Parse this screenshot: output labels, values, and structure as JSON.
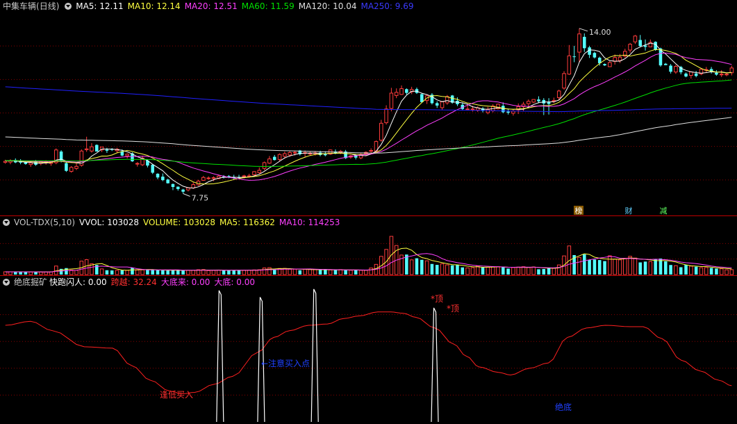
{
  "colors": {
    "up": "#ff3c3c",
    "down": "#54ffff",
    "divider": "#c00000",
    "grid": "#8a0000",
    "ma5": "#ffffff",
    "ma10": "#ffff40",
    "ma20": "#ff40ff",
    "ma60": "#00e000",
    "ma120": "#e0e0e0",
    "ma250": "#2020ff",
    "text": "#c8c8c8"
  },
  "price_panel": {
    "stock_name": "中集车辆",
    "period": "(日线)",
    "ma": [
      {
        "label": "MA5: 12.11",
        "color": "#ffffff"
      },
      {
        "label": "MA10: 12.14",
        "color": "#ffff40"
      },
      {
        "label": "MA20: 12.51",
        "color": "#ff40ff"
      },
      {
        "label": "MA60: 11.59",
        "color": "#00e000"
      },
      {
        "label": "MA120: 10.04",
        "color": "#e0e0e0"
      },
      {
        "label": "MA250: 9.69",
        "color": "#3a3aff"
      }
    ],
    "high_label": "14.00",
    "low_label": "7.75",
    "events": [
      {
        "text": "榜",
        "color": "#ffffff",
        "bg": "#8a5a00"
      },
      {
        "text": "财",
        "color": "#60d0ff",
        "bg": ""
      },
      {
        "text": "减",
        "color": "#60ff60",
        "bg": ""
      }
    ]
  },
  "volume_panel": {
    "title": "VOL-TDX(5,10)",
    "values": [
      {
        "label": "VVOL: 103028",
        "color": "#ffffff"
      },
      {
        "label": "VOLUME: 103028",
        "color": "#ffff40"
      },
      {
        "label": "MA5: 116362",
        "color": "#ffff40"
      },
      {
        "label": "MA10: 114253",
        "color": "#ff40ff"
      }
    ]
  },
  "indicator_panel": {
    "title": "绝底掘矿",
    "values": [
      {
        "label": "快跑闪人: 0.00",
        "color": "#ffffff"
      },
      {
        "label": "跨越: 32.24",
        "color": "#ff3030"
      },
      {
        "label": "大底来: 0.00",
        "color": "#ff40ff"
      },
      {
        "label": "大底: 0.00",
        "color": "#ff40ff"
      }
    ],
    "annotations": [
      {
        "text": "逢低买入",
        "color": "#ff3030"
      },
      {
        "text": "←注意买入点",
        "color": "#2040ff"
      },
      {
        "text": "*顶",
        "color": "#ff3030"
      },
      {
        "text": "*顶",
        "color": "#ff3030"
      },
      {
        "text": "绝底",
        "color": "#2040ff"
      }
    ]
  },
  "chart_data": [
    {
      "type": "candlestick",
      "title": "中集车辆(日线)",
      "ylim": [
        7.0,
        14.6
      ],
      "ohlc": [
        [
          8.93,
          9.03,
          8.88,
          8.97
        ],
        [
          8.94,
          9.05,
          8.86,
          8.99
        ],
        [
          9.02,
          9.08,
          8.9,
          8.93
        ],
        [
          8.98,
          9.05,
          8.86,
          8.92
        ],
        [
          8.93,
          9.0,
          8.84,
          8.87
        ],
        [
          8.85,
          8.97,
          8.76,
          8.91
        ],
        [
          8.97,
          9.02,
          8.8,
          8.84
        ],
        [
          8.89,
          8.96,
          8.82,
          8.95
        ],
        [
          8.92,
          9.01,
          8.84,
          8.96
        ],
        [
          8.89,
          8.96,
          8.8,
          8.95
        ],
        [
          8.92,
          9.46,
          8.86,
          9.4
        ],
        [
          9.34,
          9.39,
          8.93,
          9.0
        ],
        [
          8.9,
          8.97,
          8.57,
          8.61
        ],
        [
          8.59,
          8.79,
          8.54,
          8.74
        ],
        [
          8.7,
          8.89,
          8.64,
          8.78
        ],
        [
          8.82,
          9.42,
          8.77,
          9.36
        ],
        [
          9.41,
          9.9,
          9.33,
          9.44
        ],
        [
          9.36,
          9.66,
          9.3,
          9.52
        ],
        [
          9.59,
          9.61,
          9.34,
          9.34
        ],
        [
          9.4,
          9.52,
          9.32,
          9.51
        ],
        [
          9.41,
          9.48,
          9.29,
          9.37
        ],
        [
          9.43,
          9.47,
          9.36,
          9.42
        ],
        [
          9.37,
          9.48,
          9.28,
          9.43
        ],
        [
          9.35,
          9.42,
          9.16,
          9.19
        ],
        [
          9.18,
          9.27,
          9.08,
          9.24
        ],
        [
          9.27,
          9.31,
          8.95,
          8.97
        ],
        [
          8.87,
          8.94,
          8.77,
          8.89
        ],
        [
          8.84,
          9.18,
          8.79,
          9.09
        ],
        [
          9.0,
          9.03,
          8.74,
          8.81
        ],
        [
          8.84,
          8.86,
          8.49,
          8.54
        ],
        [
          8.5,
          8.52,
          8.29,
          8.36
        ],
        [
          8.39,
          8.51,
          8.22,
          8.26
        ],
        [
          8.28,
          8.31,
          8.13,
          8.14
        ],
        [
          8.11,
          8.13,
          7.88,
          8.0
        ],
        [
          8.01,
          8.02,
          7.86,
          7.92
        ],
        [
          7.9,
          7.93,
          7.75,
          7.82
        ],
        [
          7.89,
          8.0,
          7.83,
          7.97
        ],
        [
          7.96,
          8.18,
          7.92,
          8.09
        ],
        [
          8.08,
          8.27,
          8.04,
          8.22
        ],
        [
          8.25,
          8.42,
          8.23,
          8.36
        ],
        [
          8.32,
          8.4,
          8.28,
          8.34
        ],
        [
          8.32,
          8.4,
          8.22,
          8.35
        ],
        [
          8.32,
          8.47,
          8.29,
          8.41
        ],
        [
          8.39,
          8.45,
          8.32,
          8.38
        ],
        [
          8.41,
          8.45,
          8.33,
          8.37
        ],
        [
          8.37,
          8.46,
          8.29,
          8.33
        ],
        [
          8.37,
          8.46,
          8.3,
          8.34
        ],
        [
          8.4,
          8.46,
          8.32,
          8.42
        ],
        [
          8.4,
          8.5,
          8.38,
          8.42
        ],
        [
          8.46,
          8.6,
          8.42,
          8.58
        ],
        [
          8.54,
          8.74,
          8.5,
          8.63
        ],
        [
          8.7,
          8.96,
          8.63,
          8.92
        ],
        [
          8.9,
          9.17,
          8.87,
          9.06
        ],
        [
          9.14,
          9.21,
          9.0,
          9.02
        ],
        [
          9.04,
          9.27,
          8.98,
          9.23
        ],
        [
          9.16,
          9.34,
          9.07,
          9.26
        ],
        [
          9.21,
          9.37,
          9.14,
          9.3
        ],
        [
          9.3,
          9.37,
          9.19,
          9.31
        ],
        [
          9.38,
          9.4,
          9.19,
          9.24
        ],
        [
          9.27,
          9.38,
          9.14,
          9.3
        ],
        [
          9.25,
          9.35,
          9.18,
          9.27
        ],
        [
          9.28,
          9.36,
          9.19,
          9.29
        ],
        [
          9.3,
          9.37,
          9.16,
          9.21
        ],
        [
          9.24,
          9.35,
          9.16,
          9.2
        ],
        [
          9.24,
          9.42,
          9.21,
          9.4
        ],
        [
          9.34,
          9.42,
          9.24,
          9.26
        ],
        [
          9.29,
          9.4,
          9.24,
          9.35
        ],
        [
          9.34,
          9.4,
          9.06,
          9.09
        ],
        [
          9.13,
          9.22,
          9.07,
          9.18
        ],
        [
          9.21,
          9.25,
          9.04,
          9.11
        ],
        [
          9.1,
          9.28,
          9.05,
          9.23
        ],
        [
          9.26,
          9.35,
          9.16,
          9.31
        ],
        [
          9.35,
          9.46,
          9.27,
          9.38
        ],
        [
          9.36,
          9.76,
          9.31,
          9.72
        ],
        [
          9.77,
          10.54,
          9.71,
          10.41
        ],
        [
          10.43,
          11.09,
          10.36,
          10.95
        ],
        [
          10.97,
          11.75,
          10.86,
          11.55
        ],
        [
          11.46,
          11.73,
          11.36,
          11.58
        ],
        [
          11.5,
          11.84,
          11.48,
          11.72
        ],
        [
          11.7,
          11.73,
          11.49,
          11.56
        ],
        [
          11.6,
          11.79,
          11.51,
          11.69
        ],
        [
          11.7,
          11.76,
          11.52,
          11.56
        ],
        [
          11.51,
          11.54,
          11.18,
          11.21
        ],
        [
          11.27,
          11.51,
          11.14,
          11.45
        ],
        [
          11.49,
          11.55,
          11.12,
          11.17
        ],
        [
          11.17,
          11.24,
          10.99,
          11.08
        ],
        [
          11.0,
          11.25,
          10.91,
          11.22
        ],
        [
          11.18,
          11.48,
          11.11,
          11.42
        ],
        [
          11.46,
          11.48,
          11.15,
          11.19
        ],
        [
          11.26,
          11.39,
          11.06,
          11.13
        ],
        [
          11.11,
          11.2,
          10.89,
          10.95
        ],
        [
          10.95,
          11.12,
          10.9,
          10.95
        ],
        [
          10.95,
          11.07,
          10.85,
          10.95
        ],
        [
          10.91,
          11.05,
          10.84,
          10.99
        ],
        [
          10.97,
          11.02,
          10.82,
          10.88
        ],
        [
          10.81,
          11.03,
          10.75,
          10.93
        ],
        [
          10.88,
          11.13,
          10.82,
          11.06
        ],
        [
          10.96,
          11.15,
          10.93,
          11.13
        ],
        [
          11.07,
          11.2,
          10.79,
          10.83
        ],
        [
          10.85,
          10.93,
          10.74,
          10.81
        ],
        [
          10.79,
          10.93,
          10.7,
          10.87
        ],
        [
          10.92,
          11.16,
          10.76,
          11.04
        ],
        [
          11.04,
          11.22,
          10.88,
          11.13
        ],
        [
          11.15,
          11.31,
          11.02,
          11.24
        ],
        [
          11.21,
          11.32,
          11.17,
          11.31
        ],
        [
          11.31,
          11.43,
          11.17,
          11.24
        ],
        [
          11.29,
          11.36,
          10.72,
          11.16
        ],
        [
          11.22,
          11.36,
          10.74,
          11.14
        ],
        [
          11.24,
          11.38,
          11.16,
          11.27
        ],
        [
          11.38,
          11.68,
          11.27,
          11.63
        ],
        [
          11.74,
          12.38,
          11.68,
          12.29
        ],
        [
          12.27,
          13.37,
          12.24,
          12.96
        ],
        [
          12.94,
          13.34,
          12.72,
          12.93
        ],
        [
          13.1,
          14.0,
          12.73,
          13.79
        ],
        [
          13.68,
          13.81,
          13.11,
          13.25
        ],
        [
          13.28,
          13.34,
          12.88,
          13.0
        ],
        [
          13.07,
          13.12,
          12.86,
          12.9
        ],
        [
          12.89,
          12.93,
          12.59,
          12.68
        ],
        [
          12.65,
          12.67,
          12.58,
          12.6
        ],
        [
          12.55,
          12.76,
          12.54,
          12.71
        ],
        [
          12.75,
          13.01,
          12.63,
          12.9
        ],
        [
          12.78,
          13.03,
          12.69,
          12.91
        ],
        [
          12.95,
          13.23,
          12.89,
          13.13
        ],
        [
          13.18,
          13.45,
          13.08,
          13.4
        ],
        [
          13.49,
          13.75,
          13.41,
          13.71
        ],
        [
          13.56,
          13.75,
          13.3,
          13.33
        ],
        [
          13.35,
          13.58,
          13.16,
          13.3
        ],
        [
          13.3,
          13.58,
          13.29,
          13.47
        ],
        [
          13.49,
          13.51,
          13.15,
          13.18
        ],
        [
          13.24,
          13.27,
          12.55,
          12.6
        ],
        [
          12.66,
          12.69,
          12.61,
          12.61
        ],
        [
          12.59,
          12.65,
          12.29,
          12.36
        ],
        [
          12.35,
          12.62,
          12.28,
          12.56
        ],
        [
          12.54,
          12.58,
          12.26,
          12.34
        ],
        [
          12.29,
          12.33,
          12.15,
          12.18
        ],
        [
          12.22,
          12.37,
          12.1,
          12.35
        ],
        [
          12.29,
          12.39,
          12.15,
          12.2
        ],
        [
          12.28,
          12.5,
          12.23,
          12.45
        ],
        [
          12.43,
          12.54,
          12.33,
          12.44
        ],
        [
          12.46,
          12.54,
          12.29,
          12.36
        ],
        [
          12.32,
          12.42,
          12.21,
          12.25
        ],
        [
          12.24,
          12.42,
          12.16,
          12.27
        ],
        [
          12.24,
          12.3,
          12.19,
          12.27
        ],
        [
          12.32,
          12.59,
          12.22,
          12.5
        ]
      ]
    },
    {
      "type": "bar",
      "title": "VOL-TDX(5,10)",
      "ylim": [
        0,
        290000
      ],
      "values": [
        17430,
        17289,
        17117,
        16813,
        16337,
        16155,
        15894,
        16057,
        16259,
        16384,
        53215,
        35426,
        40200,
        28300,
        26184,
        83659,
        92730,
        67410,
        59810,
        35190,
        26955,
        25725,
        26006,
        26622,
        25924,
        43024,
        28211,
        29110,
        28690,
        28808,
        27904,
        25734,
        25294,
        26217,
        25848,
        28026,
        26307,
        26426,
        30287,
        31106,
        24916,
        26294,
        28216,
        26390,
        26300,
        26254,
        27072,
        27069,
        26985,
        29051,
        30007,
        41134,
        43140,
        30981,
        38005,
        38269,
        33600,
        33183,
        26767,
        32280,
        32040,
        30340,
        29130,
        29470,
        28934,
        28530,
        31113,
        27640,
        26922,
        27760,
        26570,
        26932,
        40820,
        63370,
        113570,
        156630,
        237910,
        181090,
        121500,
        124610,
        91430,
        101450,
        91800,
        85550,
        66030,
        60240,
        66750,
        60080,
        57370,
        58470,
        44670,
        41520,
        43270,
        52590,
        45100,
        45920,
        47710,
        48790,
        49420,
        37310,
        43780,
        46610,
        48800,
        44750,
        47160,
        32780,
        34650,
        39760,
        41480,
        59830,
        116200,
        178240,
        121330,
        106690,
        125880,
        92560,
        93540,
        90440,
        83820,
        117130,
        95100,
        91780,
        101730,
        113920,
        102710,
        75640,
        80810,
        80360,
        95680,
        99630,
        82480,
        59570,
        55280,
        45700,
        60070,
        52620,
        48890,
        42610,
        43810,
        41190,
        37090,
        36040,
        29600,
        30430
      ]
    },
    {
      "type": "line",
      "title": "绝底掘矿",
      "ylim": [
        0,
        100
      ]
    }
  ]
}
